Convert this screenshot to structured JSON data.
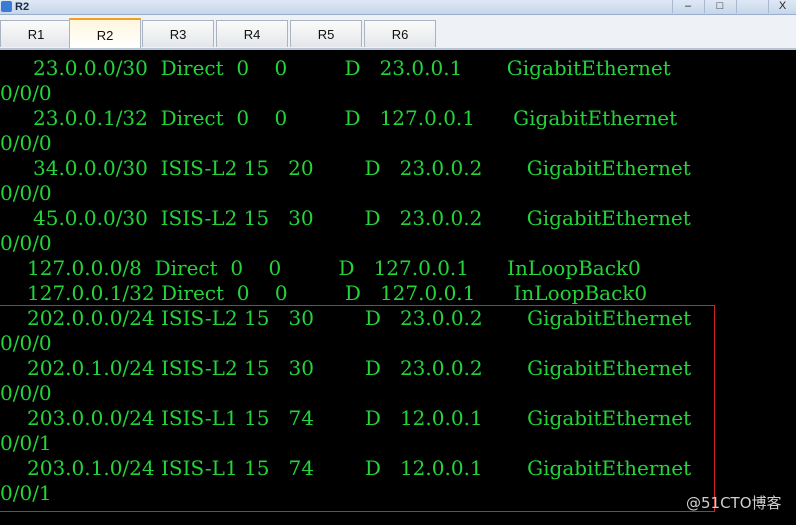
{
  "window": {
    "title": "R2",
    "minimize": "–",
    "maximize": "□",
    "close": "X"
  },
  "tabs": [
    "R1",
    "R2",
    "R3",
    "R4",
    "R5",
    "R6"
  ],
  "active_tab": "R2",
  "colors": {
    "terminal_text": "#23d53b",
    "highlight_border": "#d22424",
    "background": "#000000"
  },
  "terminal_lines": [
    "23.0.0.0/30  Direct  0    0         D   23.0.0.1       GigabitEthernet",
    "0/0/0",
    "23.0.0.1/32  Direct  0    0         D   127.0.0.1      GigabitEthernet",
    "0/0/0",
    "34.0.0.0/30  ISIS-L2 15   20        D   23.0.0.2       GigabitEthernet",
    "0/0/0",
    "45.0.0.0/30  ISIS-L2 15   30        D   23.0.0.2       GigabitEthernet",
    "0/0/0",
    "127.0.0.0/8  Direct  0    0         D   127.0.0.1      InLoopBack0",
    "127.0.0.1/32 Direct  0    0         D   127.0.0.1      InLoopBack0",
    "202.0.0.0/24 ISIS-L2 15   30        D   23.0.0.2       GigabitEthernet",
    "0/0/0",
    "202.0.1.0/24 ISIS-L2 15   30        D   23.0.0.2       GigabitEthernet",
    "0/0/0",
    "203.0.0.0/24 ISIS-L1 15   74        D   12.0.0.1       GigabitEthernet",
    "0/0/1",
    "203.0.1.0/24 ISIS-L1 15   74        D   12.0.0.1       GigabitEthernet",
    "0/0/1"
  ],
  "watermark": "@51CTO博客"
}
